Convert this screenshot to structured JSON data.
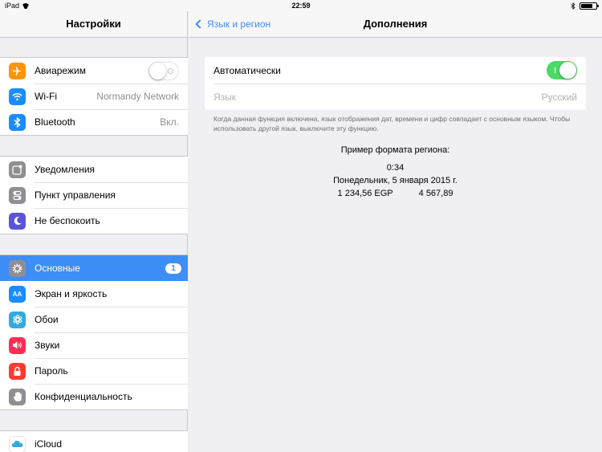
{
  "status_bar": {
    "device": "iPad",
    "time": "22:59"
  },
  "sidebar": {
    "title": "Настройки",
    "groups": [
      {
        "items": [
          {
            "label": "Авиарежим",
            "icon": "airplane-icon",
            "icon_color": "#ff9500",
            "toggle": "off"
          },
          {
            "label": "Wi-Fi",
            "value": "Normandy Network",
            "icon": "wifi-icon",
            "icon_color": "#1a8cff"
          },
          {
            "label": "Bluetooth",
            "value": "Вкл.",
            "icon": "bluetooth-icon",
            "icon_color": "#1a8cff"
          }
        ]
      },
      {
        "items": [
          {
            "label": "Уведомления",
            "icon": "notifications-icon",
            "icon_color": "#8e8e93"
          },
          {
            "label": "Пункт управления",
            "icon": "control-center-icon",
            "icon_color": "#8e8e93"
          },
          {
            "label": "Не беспокоить",
            "icon": "moon-icon",
            "icon_color": "#5856d6"
          }
        ]
      },
      {
        "items": [
          {
            "label": "Основные",
            "badge": "1",
            "icon": "gear-icon",
            "icon_color": "#8e8e93",
            "selected": true
          },
          {
            "label": "Экран и яркость",
            "icon": "display-icon",
            "icon_color": "#1a8cff",
            "icon_text": "AA"
          },
          {
            "label": "Обои",
            "icon": "wallpaper-icon",
            "icon_color": "#34aadc"
          },
          {
            "label": "Звуки",
            "icon": "speaker-icon",
            "icon_color": "#ff2d55"
          },
          {
            "label": "Пароль",
            "icon": "lock-icon",
            "icon_color": "#ff3b30"
          },
          {
            "label": "Конфиденциальность",
            "icon": "hand-icon",
            "icon_color": "#8e8e93"
          }
        ]
      },
      {
        "items": [
          {
            "label": "iCloud",
            "icon": "cloud-icon",
            "icon_color": "#ffffff"
          }
        ]
      }
    ]
  },
  "main": {
    "back_label": "Язык и регион",
    "title": "Дополнения",
    "auto_label": "Автоматически",
    "auto_toggle": "on",
    "language_label": "Язык",
    "language_value": "Русский",
    "footnote": "Когда данная функция включена, язык отображения дат, времени и цифр совпадает с основным языком. Чтобы использовать другой язык, выключите эту функцию.",
    "sample_title": "Пример формата региона:",
    "sample_time": "0:34",
    "sample_date": "Понедельник, 5 января 2015 г.",
    "sample_currency": "1 234,56 EGP",
    "sample_number": "4 567,89"
  },
  "colors": {
    "accent": "#3e8ef7",
    "toggle_on": "#4cd964",
    "background": "#efeff4"
  }
}
